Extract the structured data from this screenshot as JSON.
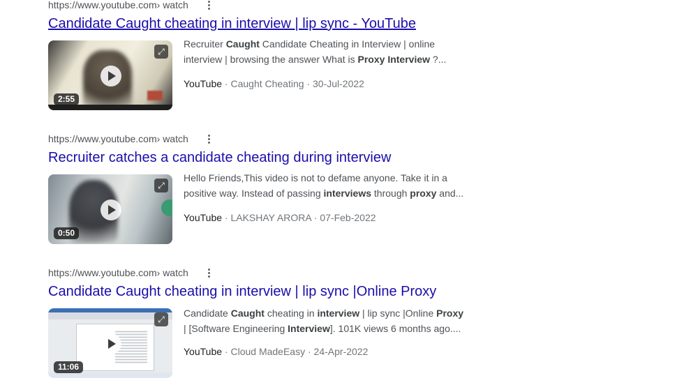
{
  "results": [
    {
      "url": "https://www.youtube.com",
      "url_path": " › watch",
      "title": "Candidate Caught cheating in interview | lip sync - YouTube",
      "duration": "2:55",
      "snippet_line1": [
        "Recruiter ",
        "Caught",
        " Candidate Cheating in Interview | online"
      ],
      "snippet_line2": [
        "interview | browsing the answer What is ",
        "Proxy Interview",
        " ?..."
      ],
      "source": "YouTube",
      "channel": "Caught Cheating",
      "date": "30-Jul-2022"
    },
    {
      "url": "https://www.youtube.com",
      "url_path": " › watch",
      "title": "Recruiter catches a candidate cheating during interview",
      "duration": "0:50",
      "snippet_line1": [
        "Hello Friends,This video is not to defame anyone. Take it in a"
      ],
      "snippet_line2": [
        "positive way. Instead of passing ",
        "interviews",
        " through ",
        "proxy",
        " and..."
      ],
      "source": "YouTube",
      "channel": "LAKSHAY ARORA",
      "date": "07-Feb-2022"
    },
    {
      "url": "https://www.youtube.com",
      "url_path": " › watch",
      "title": "Candidate Caught cheating in interview | lip sync |Online Proxy",
      "duration": "11:06",
      "snippet_line1": [
        "Candidate ",
        "Caught",
        " cheating in ",
        "interview",
        " | lip sync |Online ",
        "Proxy"
      ],
      "snippet_line2": [
        "| [Software Engineering ",
        "Interview",
        "]. 101K views 6 months ago...."
      ],
      "source": "YouTube",
      "channel": "Cloud MadeEasy",
      "date": "24-Apr-2022"
    }
  ],
  "meta_separator": " · ",
  "icons": {
    "more": "more-vert-icon",
    "expand": "expand-icon",
    "play": "play-icon"
  }
}
